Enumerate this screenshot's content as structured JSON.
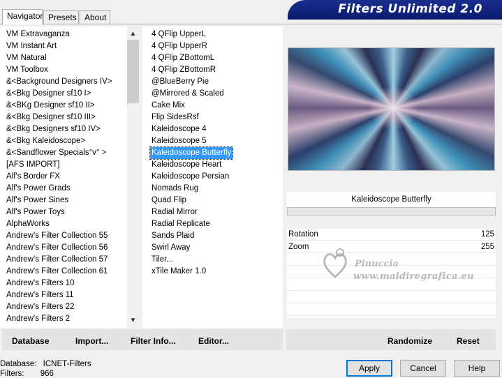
{
  "tabs": [
    "Navigator",
    "Presets",
    "About"
  ],
  "banner_title": "Filters Unlimited 2.0",
  "categories": [
    "VM Extravaganza",
    "VM Instant Art",
    "VM Natural",
    "VM Toolbox",
    "&<Background Designers IV>",
    "&<Bkg Designer sf10 I>",
    "&<BKg Designer sf10 II>",
    "&<Bkg Designer sf10 III>",
    "&<Bkg Designers sf10 IV>",
    "&<Bkg Kaleidoscope>",
    "&<Sandflower Specials°v° >",
    "[AFS IMPORT]",
    "Alf's Border FX",
    "Alf's Power Grads",
    "Alf's Power Sines",
    "Alf's Power Toys",
    "AlphaWorks",
    "Andrew's Filter Collection 55",
    "Andrew's Filter Collection 56",
    "Andrew's Filter Collection 57",
    "Andrew's Filter Collection 61",
    "Andrew's Filters 10",
    "Andrew's Filters 11",
    "Andrew's Filters 22",
    "Andrew's Filters 2"
  ],
  "filters": [
    "4 QFlip UpperL",
    "4 QFlip UpperR",
    "4 QFlip ZBottomL",
    "4 QFlip ZBottomR",
    "@BlueBerry Pie",
    "@Mirrored & Scaled",
    "Cake Mix",
    "Flip SidesRsf",
    "Kaleidoscope 4",
    "Kaleidoscope 5",
    "Kaleidoscope Butterfly",
    "Kaleidoscope Heart",
    "Kaleidoscope Persian",
    "Nomads Rug",
    "Quad Flip",
    "Radial Mirror",
    "Radial Replicate",
    "Sands Plaid",
    "Swirl Away",
    "Tiler...",
    "xTile Maker 1.0"
  ],
  "selected_filter_index": 10,
  "selected_category_index": 9,
  "filter_name": "Kaleidoscope Butterfly",
  "params": [
    {
      "label": "Rotation",
      "value": "125"
    },
    {
      "label": "Zoom",
      "value": "255"
    }
  ],
  "watermark": {
    "name": "Pinuccia",
    "url": "www.maldiregrafica.eu"
  },
  "left_buttons": [
    "Database",
    "Import...",
    "Filter Info...",
    "Editor..."
  ],
  "right_buttons": [
    "Randomize",
    "Reset"
  ],
  "status": {
    "database_label": "Database:",
    "database_value": "ICNET-Filters",
    "filters_label": "Filters:",
    "filters_value": "966"
  },
  "dialog_buttons": [
    "Apply",
    "Cancel",
    "Help"
  ]
}
